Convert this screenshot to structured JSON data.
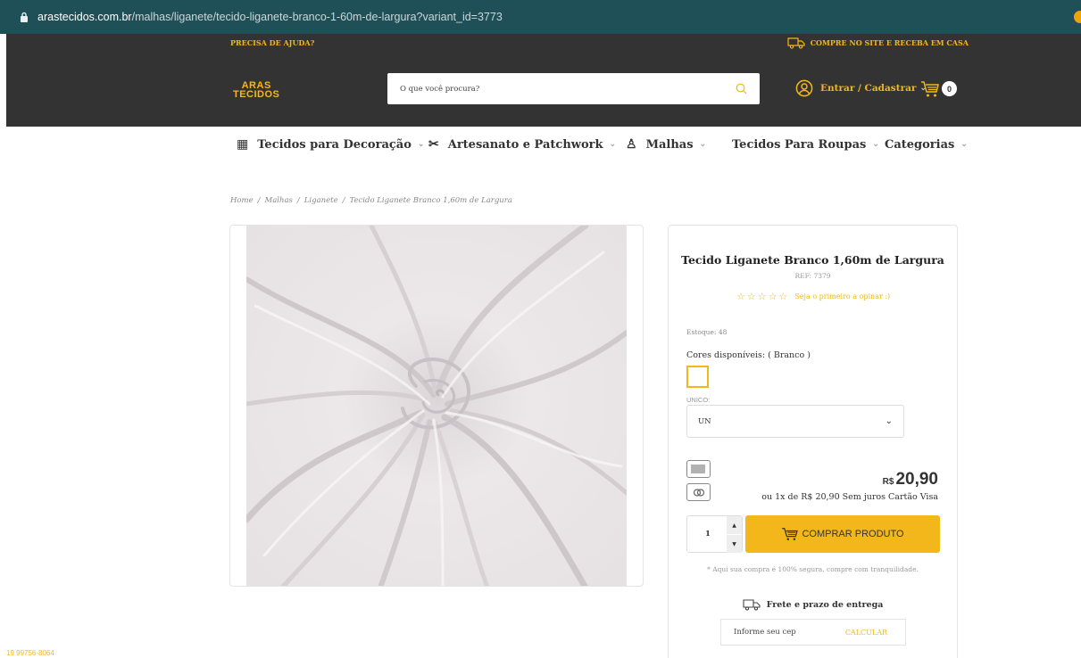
{
  "browser": {
    "url_host": "arastecidos.com.br",
    "url_path": "/malhas/liganete/tecido-liganete-branco-1-60m-de-largura?variant_id=3773"
  },
  "header": {
    "help_text": "PRECISA DE AJUDA?",
    "shipping_text": "COMPRE NO SITE E RECEBA EM CASA",
    "logo_line1": "ARAS",
    "logo_line2": "TECIDOS",
    "search_placeholder": "O que você procura?",
    "login_text": "Entrar / Cadastrar",
    "cart_count": "0",
    "accent_color": "#f4b71b",
    "bg_color": "#333333"
  },
  "nav": {
    "items": [
      {
        "label": "Tecidos para Decoração",
        "icon": "fabric-roll-icon"
      },
      {
        "label": "Artesanato e Patchwork",
        "icon": "sewing-icon"
      },
      {
        "label": "Malhas",
        "icon": "shirt-icon"
      },
      {
        "label": "Tecidos Para Roupas",
        "icon": ""
      },
      {
        "label": "Categorias",
        "icon": ""
      }
    ]
  },
  "breadcrumb": [
    "Home",
    "Malhas",
    "Liganete",
    "Tecido Liganete Branco 1,60m de Largura"
  ],
  "product": {
    "title": "Tecido Liganete Branco 1,60m de Largura",
    "ref": "REF: 7379",
    "rating_text": "Seja o primeiro a opinar :)",
    "stars": "☆☆☆☆☆",
    "stock": "Estoque: 48",
    "colors_label": "Cores disponíveis: ( Branco )",
    "variant_label": "UNICO:",
    "variant_value": "UN",
    "price_currency": "R$",
    "price_amount": "20,90",
    "installments": "ou 1x de R$ 20,90 Sem juros Cartão Visa",
    "quantity": "1",
    "buy_label": "COMPRAR PRODUTO",
    "secure_text": "* Aqui sua compra é 100% segura, compre com tranquilidade.",
    "shipping_title": "Frete e prazo de entrega",
    "cep_placeholder": "Informe seu cep",
    "calc_label": "CALCULAR"
  },
  "footer": {
    "phone": "19 99756-8064"
  }
}
